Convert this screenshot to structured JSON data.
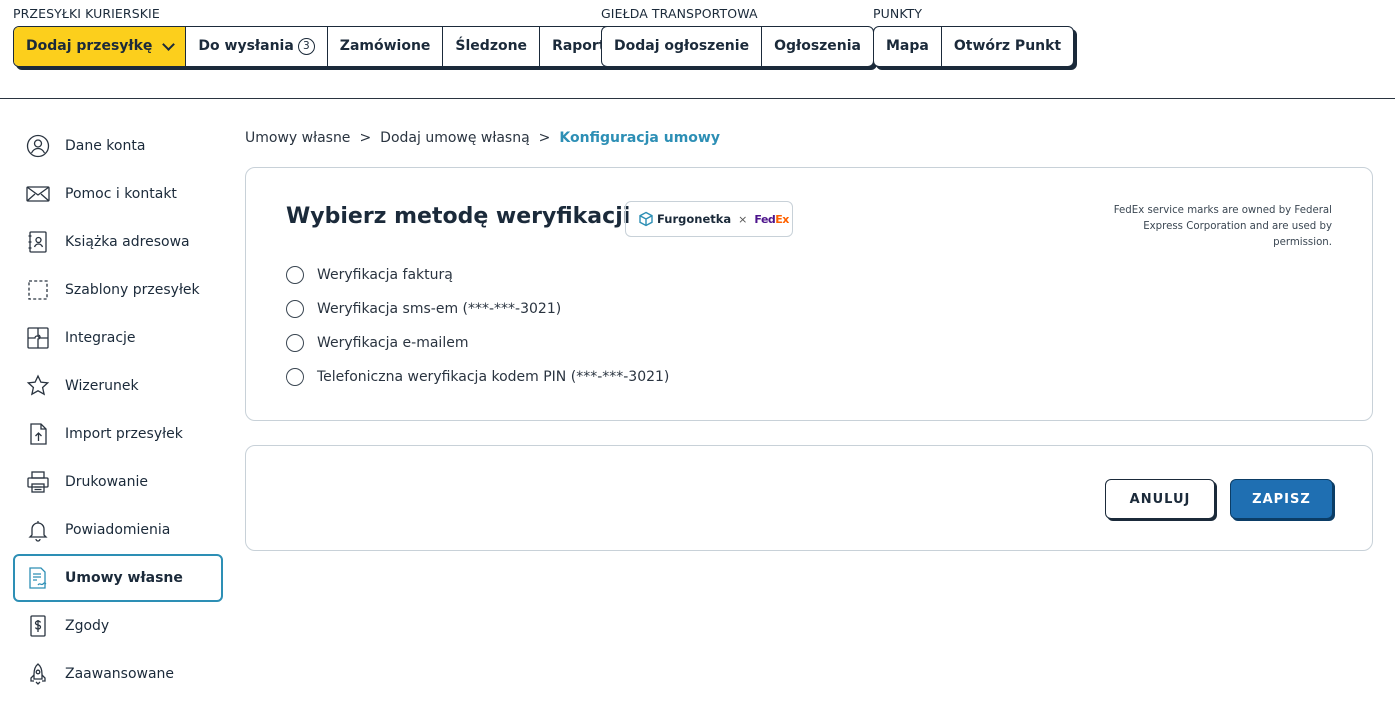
{
  "nav": {
    "groups": [
      {
        "title": "PRZESYŁKI KURIERSKIE",
        "buttons": [
          {
            "label": "Dodaj przesyłkę"
          },
          {
            "label": "Do wysłania",
            "badge": "3"
          },
          {
            "label": "Zamówione"
          },
          {
            "label": "Śledzone"
          },
          {
            "label": "Raporty"
          }
        ]
      },
      {
        "title": "GIEŁDA TRANSPORTOWA",
        "buttons": [
          {
            "label": "Dodaj ogłoszenie"
          },
          {
            "label": "Ogłoszenia"
          }
        ]
      },
      {
        "title": "PUNKTY",
        "buttons": [
          {
            "label": "Mapa"
          },
          {
            "label": "Otwórz Punkt"
          }
        ]
      }
    ]
  },
  "sidebar": {
    "items": [
      {
        "label": "Dane konta",
        "icon": "user-icon"
      },
      {
        "label": "Pomoc i kontakt",
        "icon": "envelope-icon"
      },
      {
        "label": "Książka adresowa",
        "icon": "address-book-icon"
      },
      {
        "label": "Szablony przesyłek",
        "icon": "template-icon"
      },
      {
        "label": "Integracje",
        "icon": "puzzle-icon"
      },
      {
        "label": "Wizerunek",
        "icon": "star-icon"
      },
      {
        "label": "Import przesyłek",
        "icon": "import-icon"
      },
      {
        "label": "Drukowanie",
        "icon": "printer-icon"
      },
      {
        "label": "Powiadomienia",
        "icon": "bell-icon"
      },
      {
        "label": "Umowy własne",
        "icon": "contract-icon",
        "active": true
      },
      {
        "label": "Zgody",
        "icon": "document-icon"
      },
      {
        "label": "Zaawansowane",
        "icon": "rocket-icon"
      }
    ]
  },
  "breadcrumb": {
    "items": [
      "Umowy własne",
      "Dodaj umowę własną"
    ],
    "separator": ">",
    "current": "Konfiguracja umowy"
  },
  "verification": {
    "title": "Wybierz metodę weryfikacji",
    "brand": {
      "partner": "Furgonetka",
      "times": "×",
      "carrier_a": "Fed",
      "carrier_b": "Ex"
    },
    "notice": "FedEx service marks are owned by Federal Express Corporation and are used by permission.",
    "options": [
      {
        "label": "Weryfikacja fakturą"
      },
      {
        "label": "Weryfikacja sms-em (***-***-3021)"
      },
      {
        "label": "Weryfikacja e-mailem"
      },
      {
        "label": "Telefoniczna weryfikacja kodem PIN (***-***-3021)"
      }
    ]
  },
  "actions": {
    "cancel_label": "ANULUJ",
    "save_label": "ZAPISZ"
  },
  "colors": {
    "primary_yellow": "#fccf1c",
    "accent_blue": "#2d8fb5",
    "save_blue": "#1f6fb2",
    "text_dark": "#1b2a3a"
  }
}
